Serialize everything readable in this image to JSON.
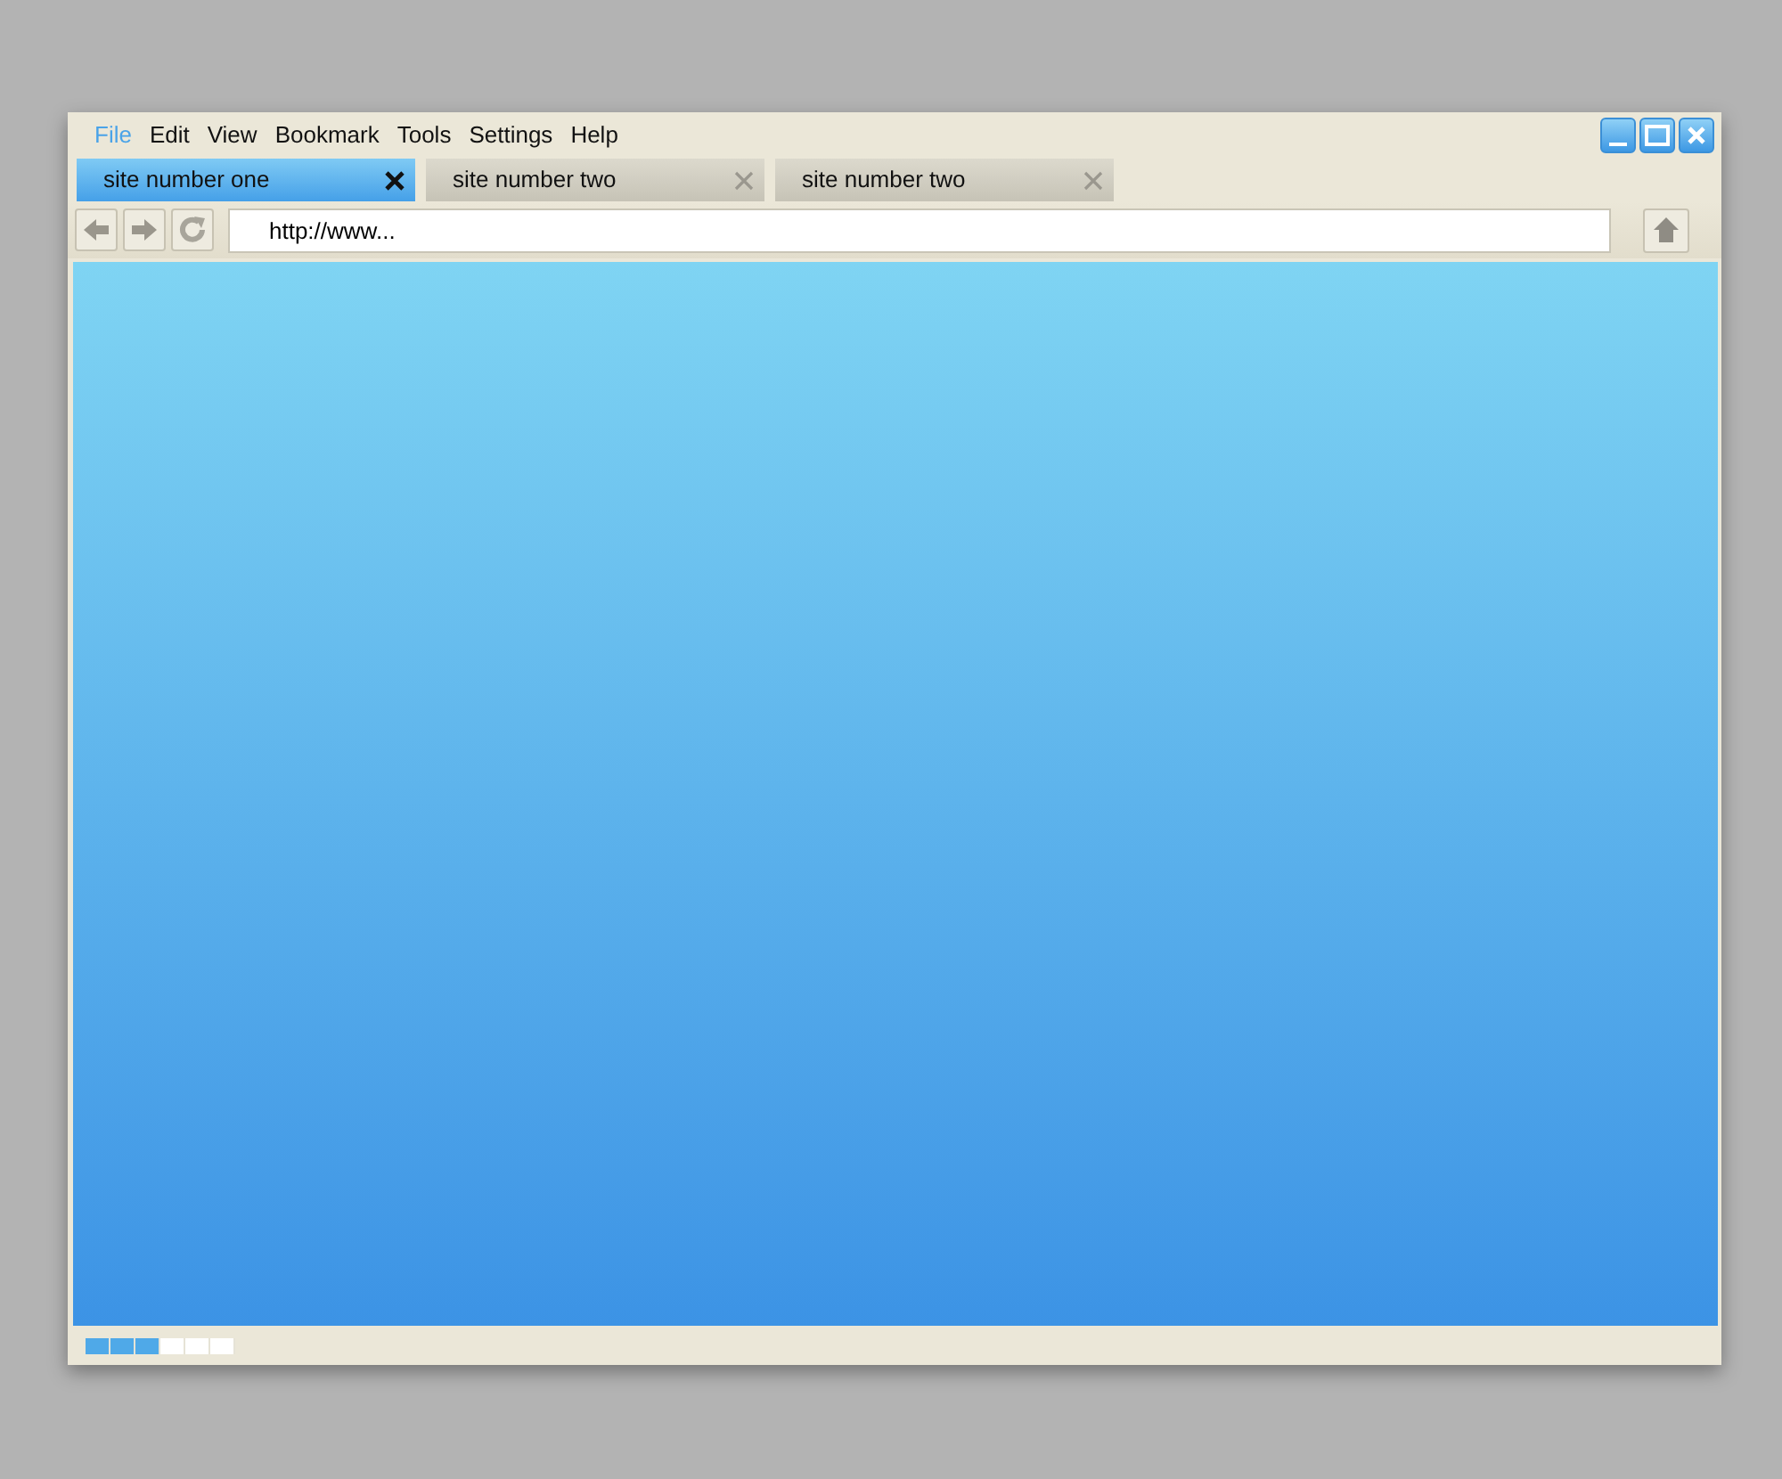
{
  "menu": [
    {
      "label": "File",
      "selected": true
    },
    {
      "label": "Edit",
      "selected": false
    },
    {
      "label": "View",
      "selected": false
    },
    {
      "label": "Bookmark",
      "selected": false
    },
    {
      "label": "Tools",
      "selected": false
    },
    {
      "label": "Settings",
      "selected": false
    },
    {
      "label": "Help",
      "selected": false
    }
  ],
  "tabs": [
    {
      "label": "site number one",
      "selected": true
    },
    {
      "label": "site number two",
      "selected": false
    },
    {
      "label": "site number two",
      "selected": false
    }
  ],
  "address_bar": {
    "value": "http://www..."
  },
  "status_bar": {
    "progress": {
      "level": 0.5
    }
  }
}
